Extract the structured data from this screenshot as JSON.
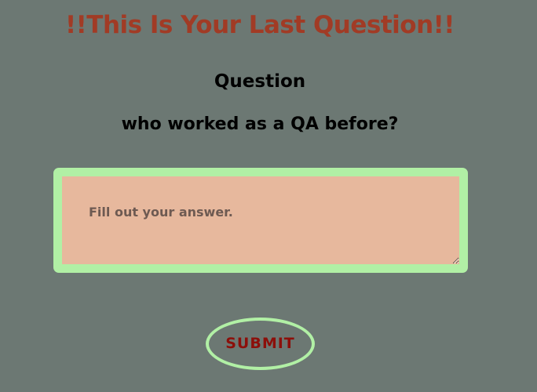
{
  "banner": {
    "text": "!!This Is Your Last Question!!"
  },
  "question": {
    "heading": "Question",
    "text": "who worked as a QA before?"
  },
  "answer": {
    "placeholder": "Fill out your answer.",
    "value": ""
  },
  "submit": {
    "label": "SUBMIT"
  },
  "colors": {
    "background": "#6c7873",
    "banner": "#a13b25",
    "frame": "#b1f0a5",
    "input": "#e7b89d",
    "submit_text": "#8c0f0a"
  }
}
